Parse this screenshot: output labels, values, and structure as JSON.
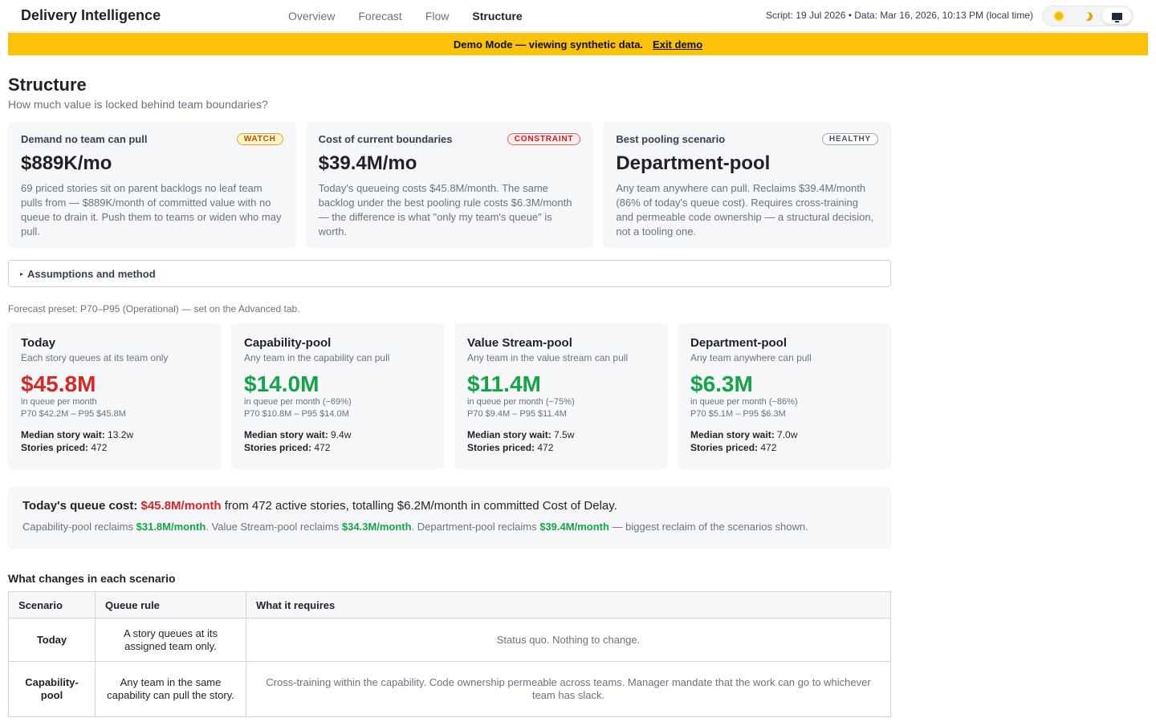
{
  "app": {
    "title": "Delivery Intelligence",
    "nav": [
      "Overview",
      "Forecast",
      "Flow",
      "Structure"
    ],
    "active_nav": "Structure",
    "meta": "Script: 19 Jul 2026 • Data: Mar 16, 2026, 10:13 PM (local time)",
    "theme_options": [
      "sun-icon",
      "moon-icon",
      "monitor-icon"
    ],
    "active_theme": "monitor-icon"
  },
  "banner": {
    "text": "Demo Mode — viewing synthetic data.",
    "link": "Exit demo",
    "color": "#fcc10a"
  },
  "page": {
    "title": "Structure",
    "subtitle": "How much value is locked behind team boundaries?"
  },
  "summary_cards": [
    {
      "title": "Demand no team can pull",
      "badge": "WATCH",
      "value": "$889K/mo",
      "text": "69 priced stories sit on parent backlogs no leaf team pulls from — $889K/month of committed value with no queue to drain it. Push them to teams or widen who may pull."
    },
    {
      "title": "Cost of current boundaries",
      "badge": "CONSTRAINT",
      "value": "$39.4M/mo",
      "text": "Today's queueing costs $45.8M/month. The same backlog under the best pooling rule costs $6.3M/month — the difference is what \"only my team's queue\" is worth."
    },
    {
      "title": "Best pooling scenario",
      "badge": "HEALTHY",
      "value": "Department-pool",
      "text": "Any team anywhere can pull. Reclaims $39.4M/month (86% of today's queue cost). Requires cross-training and permeable code ownership — a structural decision, not a tooling one."
    }
  ],
  "assumptions": {
    "label": "Assumptions and method"
  },
  "preset": "Forecast preset: P70–P95 (Operational) — set on the Advanced tab.",
  "scenarios": [
    {
      "title": "Today",
      "sub": "Each story queues at its team only",
      "value": "$45.8M",
      "per": "in queue per month",
      "range": "P70 $42.2M – P95 $45.8M",
      "wait_label": "Median story wait:",
      "wait": "13.2w",
      "priced_label": "Stories priced:",
      "priced": "472"
    },
    {
      "title": "Capability-pool",
      "sub": "Any team in the capability can pull",
      "value": "$14.0M",
      "per": "in queue per month (−69%)",
      "range": "P70 $10.8M – P95 $14.0M",
      "wait_label": "Median story wait:",
      "wait": "9.4w",
      "priced_label": "Stories priced:",
      "priced": "472"
    },
    {
      "title": "Value Stream-pool",
      "sub": "Any team in the value stream can pull",
      "value": "$11.4M",
      "per": "in queue per month (−75%)",
      "range": "P70 $9.4M – P95 $11.4M",
      "wait_label": "Median story wait:",
      "wait": "7.5w",
      "priced_label": "Stories priced:",
      "priced": "472"
    },
    {
      "title": "Department-pool",
      "sub": "Any team anywhere can pull",
      "value": "$6.3M",
      "per": "in queue per month (−86%)",
      "range": "P70 $5.1M – P95 $6.3M",
      "wait_label": "Median story wait:",
      "wait": "7.0w",
      "priced_label": "Stories priced:",
      "priced": "472"
    }
  ],
  "queue_cost": {
    "label": "Today's queue cost:",
    "value": "$45.8M/month",
    "rest": " from 472 active stories, totalling $6.2M/month in committed Cost of Delay.",
    "cap_pre": "Capability-pool reclaims ",
    "cap_val": "$31.8M/month",
    "vs_pre": ". Value Stream-pool reclaims ",
    "vs_val": "$34.3M/month",
    "dep_pre": ". Department-pool reclaims ",
    "dep_val": "$39.4M/month",
    "tail": " — biggest reclaim of the scenarios shown."
  },
  "changes_table": {
    "title": "What changes in each scenario",
    "headers": [
      "Scenario",
      "Queue rule",
      "What it requires"
    ],
    "rows": [
      {
        "scenario": "Today",
        "rule": "A story queues at its assigned team only.",
        "requires": "Status quo. Nothing to change."
      },
      {
        "scenario": "Capability-pool",
        "rule": "Any team in the same capability can pull the story.",
        "requires": "Cross-training within the capability. Code ownership permeable across teams. Manager mandate that the work can go to whichever team has slack."
      }
    ]
  },
  "colors": {
    "negative": "#d62828",
    "positive": "#16a34a",
    "banner": "#fcc10a"
  }
}
